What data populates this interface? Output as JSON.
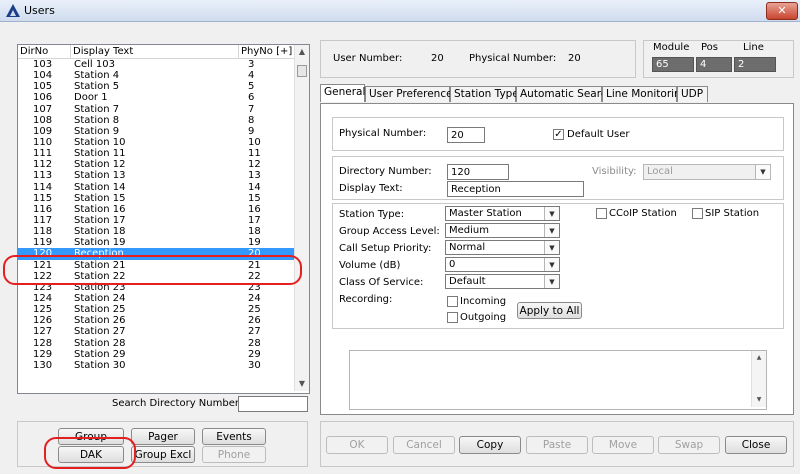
{
  "window": {
    "title": "Users",
    "close_label": "✕"
  },
  "list": {
    "headers": [
      "DirNo",
      "Display Text",
      "PhyNo [+]"
    ],
    "rows": [
      [
        "103",
        "Cell 103",
        "3"
      ],
      [
        "104",
        "Station 4",
        "4"
      ],
      [
        "105",
        "Station 5",
        "5"
      ],
      [
        "106",
        "Door 1",
        "6"
      ],
      [
        "107",
        "Station 7",
        "7"
      ],
      [
        "108",
        "Station 8",
        "8"
      ],
      [
        "109",
        "Station 9",
        "9"
      ],
      [
        "110",
        "Station 10",
        "10"
      ],
      [
        "111",
        "Station 11",
        "11"
      ],
      [
        "112",
        "Station 12",
        "12"
      ],
      [
        "113",
        "Station 13",
        "13"
      ],
      [
        "114",
        "Station 14",
        "14"
      ],
      [
        "115",
        "Station 15",
        "15"
      ],
      [
        "116",
        "Station 16",
        "16"
      ],
      [
        "117",
        "Station 17",
        "17"
      ],
      [
        "118",
        "Station 18",
        "18"
      ],
      [
        "119",
        "Station 19",
        "19"
      ],
      [
        "120",
        "Reception",
        "20"
      ],
      [
        "121",
        "Station 21",
        "21"
      ],
      [
        "122",
        "Station 22",
        "22"
      ],
      [
        "123",
        "Station 23",
        "23"
      ],
      [
        "124",
        "Station 24",
        "24"
      ],
      [
        "125",
        "Station 25",
        "25"
      ],
      [
        "126",
        "Station 26",
        "26"
      ],
      [
        "127",
        "Station 27",
        "27"
      ],
      [
        "128",
        "Station 28",
        "28"
      ],
      [
        "129",
        "Station 29",
        "29"
      ],
      [
        "130",
        "Station 30",
        "30"
      ]
    ],
    "selected_dirno": "120"
  },
  "search": {
    "label": "Search Directory Number:",
    "value": ""
  },
  "left_buttons": {
    "group": "Group",
    "pager": "Pager",
    "events": "Events",
    "dak": "DAK",
    "group_excl": "Group Excl",
    "phone": "Phone"
  },
  "header_info": {
    "user_number_label": "User Number:",
    "user_number": "20",
    "physical_number_label": "Physical Number:",
    "physical_number": "20",
    "module_label": "Module",
    "pos_label": "Pos",
    "line_label": "Line",
    "module": "65",
    "pos": "4",
    "line": "2"
  },
  "tabs": [
    "General",
    "User Preferences",
    "Station Type",
    "Automatic Search",
    "Line Monitoring",
    "UDP"
  ],
  "active_tab": "General",
  "general": {
    "physical_number_label": "Physical Number:",
    "physical_number": "20",
    "default_user_label": "Default User",
    "default_user_checked": "✓",
    "directory_number_label": "Directory Number:",
    "directory_number": "120",
    "visibility_label": "Visibility:",
    "visibility": "Local",
    "display_text_label": "Display Text:",
    "display_text": "Reception",
    "station_type_label": "Station Type:",
    "station_type": "Master Station",
    "group_access_label": "Group Access Level:",
    "group_access": "Medium",
    "call_setup_label": "Call Setup Priority:",
    "call_setup": "Normal",
    "volume_label": "Volume (dB)",
    "volume": "0",
    "class_of_service_label": "Class Of Service:",
    "class_of_service": "Default",
    "recording_label": "Recording:",
    "incoming_label": "Incoming",
    "outgoing_label": "Outgoing",
    "apply_to_all": "Apply to All",
    "ccoip_label": "CCoIP Station",
    "sip_label": "SIP Station"
  },
  "bottom_buttons": {
    "ok": "OK",
    "cancel": "Cancel",
    "copy": "Copy",
    "paste": "Paste",
    "move": "Move",
    "swap": "Swap",
    "close": "Close"
  }
}
